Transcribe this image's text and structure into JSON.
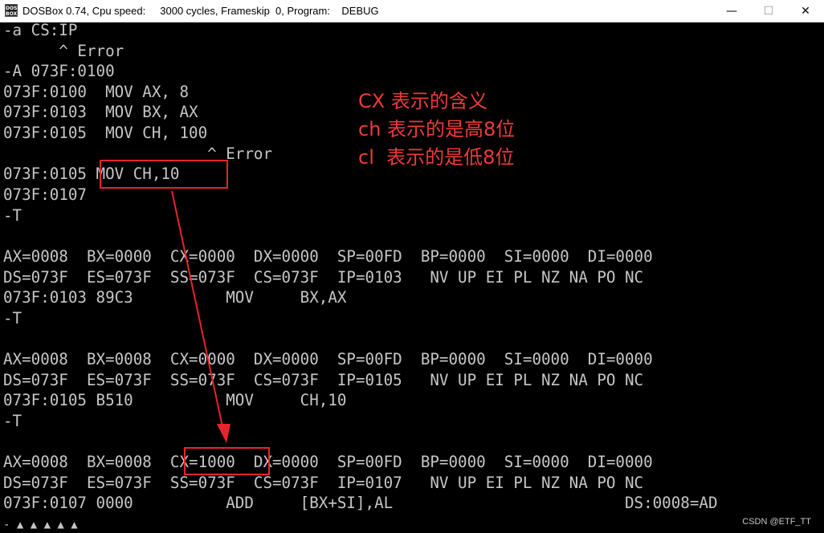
{
  "window": {
    "title": "DOSBox 0.74, Cpu speed:     3000 cycles, Frameskip  0, Program:    DEBUG",
    "icon_label_top": "DOS",
    "icon_label_bottom": "BOX",
    "minimize": "—",
    "maximize": "☐",
    "close": "✕"
  },
  "console": {
    "lines": [
      "-a CS:IP",
      "      ^ Error",
      "-A 073F:0100",
      "073F:0100  MOV AX, 8",
      "073F:0103  MOV BX, AX",
      "073F:0105  MOV CH, 100",
      "                      ^ Error",
      "073F:0105 MOV CH,10",
      "073F:0107",
      "-T",
      "",
      "AX=0008  BX=0000  CX=0000  DX=0000  SP=00FD  BP=0000  SI=0000  DI=0000",
      "DS=073F  ES=073F  SS=073F  CS=073F  IP=0103   NV UP EI PL NZ NA PO NC",
      "073F:0103 89C3          MOV     BX,AX",
      "-T",
      "",
      "AX=0008  BX=0008  CX=0000  DX=0000  SP=00FD  BP=0000  SI=0000  DI=0000",
      "DS=073F  ES=073F  SS=073F  CS=073F  IP=0105   NV UP EI PL NZ NA PO NC",
      "073F:0105 B510          MOV     CH,10",
      "-T",
      "",
      "AX=0008  BX=0008  CX=1000  DX=0000  SP=00FD  BP=0000  SI=0000  DI=0000",
      "DS=073F  ES=073F  SS=073F  CS=073F  IP=0107   NV UP EI PL NZ NA PO NC",
      "073F:0107 0000          ADD     [BX+SI],AL                         DS:0008=AD"
    ],
    "prompt_bottom": "- ▲ ▲ ▲ ▲ ▲"
  },
  "annotations": [
    "CX 表示的含义",
    "ch 表示的是高8位",
    "cl  表示的是低8位"
  ],
  "highlight_color": "#e8242a",
  "annotation_color": "#f03a3a",
  "watermark": "CSDN @ETF_TT"
}
